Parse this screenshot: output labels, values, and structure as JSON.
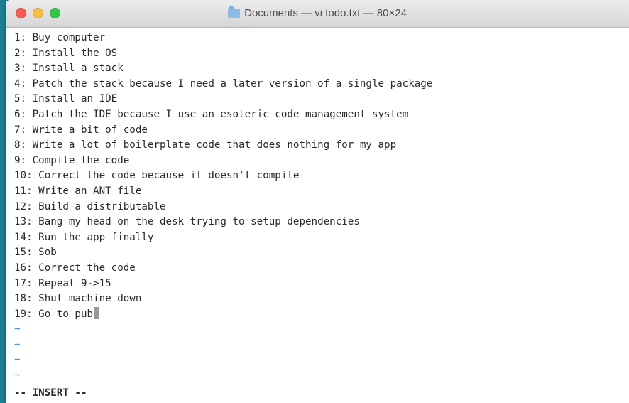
{
  "window": {
    "title": "Documents — vi todo.txt — 80×24",
    "folder_icon": "folder-icon"
  },
  "editor": {
    "lines": [
      "1: Buy computer",
      "2: Install the OS",
      "3: Install a stack",
      "4: Patch the stack because I need a later version of a single package",
      "5: Install an IDE",
      "6: Patch the IDE because I use an esoteric code management system",
      "7: Write a bit of code",
      "8: Write a lot of boilerplate code that does nothing for my app",
      "9: Compile the code",
      "10: Correct the code because it doesn't compile",
      "11: Write an ANT file",
      "12: Build a distributable",
      "13: Bang my head on the desk trying to setup dependencies",
      "14: Run the app finally",
      "15: Sob",
      "16: Correct the code",
      "17: Repeat 9->15",
      "18: Shut machine down",
      "19: Go to pub"
    ],
    "empty_line_marker": "~",
    "mode": "-- INSERT --"
  },
  "colors": {
    "desktop": "#1f7f92",
    "tilde": "#4a7fd6",
    "text": "#2a2a2a"
  }
}
